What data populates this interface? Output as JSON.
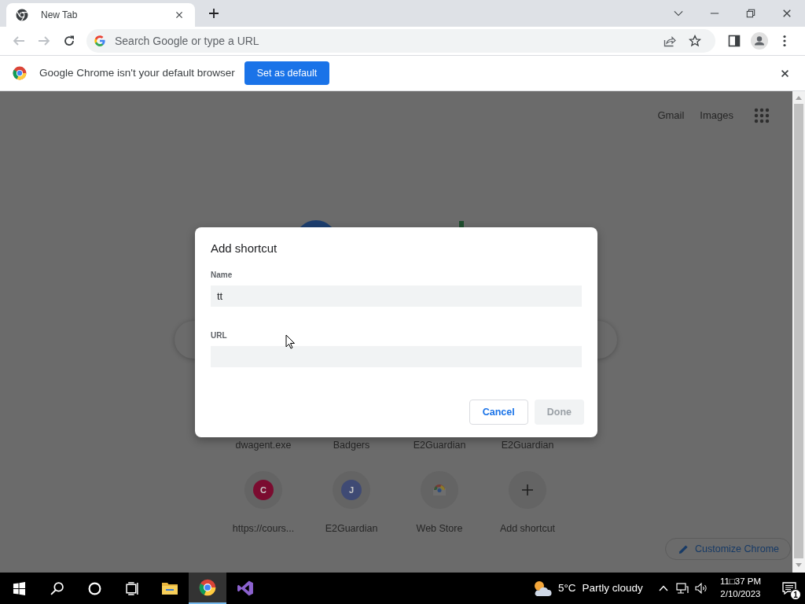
{
  "tabs": [
    {
      "title": "New Tab",
      "selected": true
    }
  ],
  "nav_buttons": [
    {
      "kind": "back",
      "disabled": true
    },
    {
      "kind": "forward",
      "disabled": true
    },
    {
      "kind": "reload",
      "disabled": false
    }
  ],
  "omnibox": {
    "placeholder": "Search Google or type a URL"
  },
  "infobar": {
    "message": "Google Chrome isn't your default browser",
    "button": "Set as default"
  },
  "header_links": [
    "Gmail",
    "Images"
  ],
  "shortcuts": [
    {
      "label": "dwagent.exe",
      "kind": "hidden"
    },
    {
      "label": "Badgers",
      "kind": "hidden"
    },
    {
      "label": "E2Guardian",
      "kind": "hidden"
    },
    {
      "label": "E2Guardian",
      "kind": "hidden"
    },
    {
      "label": "https://cours...",
      "kind": "letter",
      "letter": "C",
      "color": "#7b0c30"
    },
    {
      "label": "E2Guardian",
      "kind": "letter",
      "letter": "J",
      "color": "#3f4a74"
    },
    {
      "label": "Web Store",
      "kind": "webstore"
    },
    {
      "label": "Add shortcut",
      "kind": "add"
    }
  ],
  "customize_button": "Customize Chrome",
  "dialog": {
    "title": "Add shortcut",
    "fields": [
      {
        "label": "Name",
        "value": "tt"
      },
      {
        "label": "URL"
      }
    ],
    "buttons": [
      {
        "label": "Cancel",
        "disabled": false
      },
      {
        "label": "Done",
        "disabled": true
      }
    ]
  },
  "taskbar": {
    "apps": [
      {
        "kind": "start",
        "selected": false
      },
      {
        "kind": "search",
        "selected": false
      },
      {
        "kind": "cortana",
        "selected": false
      },
      {
        "kind": "taskview",
        "selected": false
      },
      {
        "kind": "explorer",
        "selected": false
      },
      {
        "kind": "chrome",
        "selected": true
      },
      {
        "kind": "studio",
        "selected": false
      }
    ],
    "weather": {
      "temp": "5°C",
      "condition": "Partly cloudy"
    },
    "time": "11□37 PM",
    "date": "2/10/2023",
    "notifications": "1"
  }
}
